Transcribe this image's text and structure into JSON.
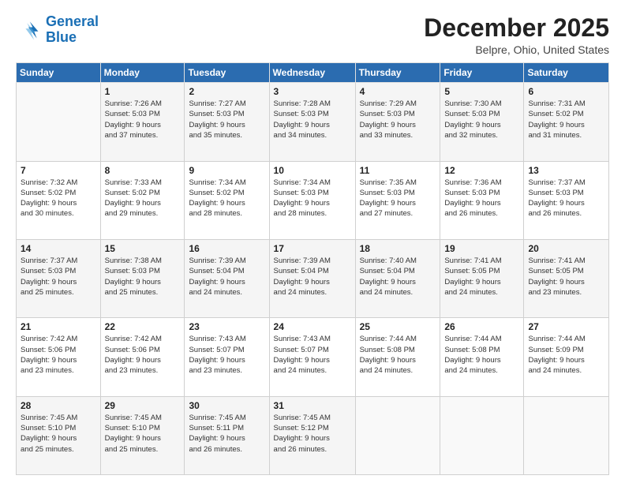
{
  "logo": {
    "line1": "General",
    "line2": "Blue"
  },
  "title": "December 2025",
  "subtitle": "Belpre, Ohio, United States",
  "days_of_week": [
    "Sunday",
    "Monday",
    "Tuesday",
    "Wednesday",
    "Thursday",
    "Friday",
    "Saturday"
  ],
  "weeks": [
    [
      {
        "day": "",
        "info": ""
      },
      {
        "day": "1",
        "info": "Sunrise: 7:26 AM\nSunset: 5:03 PM\nDaylight: 9 hours\nand 37 minutes."
      },
      {
        "day": "2",
        "info": "Sunrise: 7:27 AM\nSunset: 5:03 PM\nDaylight: 9 hours\nand 35 minutes."
      },
      {
        "day": "3",
        "info": "Sunrise: 7:28 AM\nSunset: 5:03 PM\nDaylight: 9 hours\nand 34 minutes."
      },
      {
        "day": "4",
        "info": "Sunrise: 7:29 AM\nSunset: 5:03 PM\nDaylight: 9 hours\nand 33 minutes."
      },
      {
        "day": "5",
        "info": "Sunrise: 7:30 AM\nSunset: 5:03 PM\nDaylight: 9 hours\nand 32 minutes."
      },
      {
        "day": "6",
        "info": "Sunrise: 7:31 AM\nSunset: 5:02 PM\nDaylight: 9 hours\nand 31 minutes."
      }
    ],
    [
      {
        "day": "7",
        "info": "Sunrise: 7:32 AM\nSunset: 5:02 PM\nDaylight: 9 hours\nand 30 minutes."
      },
      {
        "day": "8",
        "info": "Sunrise: 7:33 AM\nSunset: 5:02 PM\nDaylight: 9 hours\nand 29 minutes."
      },
      {
        "day": "9",
        "info": "Sunrise: 7:34 AM\nSunset: 5:02 PM\nDaylight: 9 hours\nand 28 minutes."
      },
      {
        "day": "10",
        "info": "Sunrise: 7:34 AM\nSunset: 5:03 PM\nDaylight: 9 hours\nand 28 minutes."
      },
      {
        "day": "11",
        "info": "Sunrise: 7:35 AM\nSunset: 5:03 PM\nDaylight: 9 hours\nand 27 minutes."
      },
      {
        "day": "12",
        "info": "Sunrise: 7:36 AM\nSunset: 5:03 PM\nDaylight: 9 hours\nand 26 minutes."
      },
      {
        "day": "13",
        "info": "Sunrise: 7:37 AM\nSunset: 5:03 PM\nDaylight: 9 hours\nand 26 minutes."
      }
    ],
    [
      {
        "day": "14",
        "info": "Sunrise: 7:37 AM\nSunset: 5:03 PM\nDaylight: 9 hours\nand 25 minutes."
      },
      {
        "day": "15",
        "info": "Sunrise: 7:38 AM\nSunset: 5:03 PM\nDaylight: 9 hours\nand 25 minutes."
      },
      {
        "day": "16",
        "info": "Sunrise: 7:39 AM\nSunset: 5:04 PM\nDaylight: 9 hours\nand 24 minutes."
      },
      {
        "day": "17",
        "info": "Sunrise: 7:39 AM\nSunset: 5:04 PM\nDaylight: 9 hours\nand 24 minutes."
      },
      {
        "day": "18",
        "info": "Sunrise: 7:40 AM\nSunset: 5:04 PM\nDaylight: 9 hours\nand 24 minutes."
      },
      {
        "day": "19",
        "info": "Sunrise: 7:41 AM\nSunset: 5:05 PM\nDaylight: 9 hours\nand 24 minutes."
      },
      {
        "day": "20",
        "info": "Sunrise: 7:41 AM\nSunset: 5:05 PM\nDaylight: 9 hours\nand 23 minutes."
      }
    ],
    [
      {
        "day": "21",
        "info": "Sunrise: 7:42 AM\nSunset: 5:06 PM\nDaylight: 9 hours\nand 23 minutes."
      },
      {
        "day": "22",
        "info": "Sunrise: 7:42 AM\nSunset: 5:06 PM\nDaylight: 9 hours\nand 23 minutes."
      },
      {
        "day": "23",
        "info": "Sunrise: 7:43 AM\nSunset: 5:07 PM\nDaylight: 9 hours\nand 23 minutes."
      },
      {
        "day": "24",
        "info": "Sunrise: 7:43 AM\nSunset: 5:07 PM\nDaylight: 9 hours\nand 24 minutes."
      },
      {
        "day": "25",
        "info": "Sunrise: 7:44 AM\nSunset: 5:08 PM\nDaylight: 9 hours\nand 24 minutes."
      },
      {
        "day": "26",
        "info": "Sunrise: 7:44 AM\nSunset: 5:08 PM\nDaylight: 9 hours\nand 24 minutes."
      },
      {
        "day": "27",
        "info": "Sunrise: 7:44 AM\nSunset: 5:09 PM\nDaylight: 9 hours\nand 24 minutes."
      }
    ],
    [
      {
        "day": "28",
        "info": "Sunrise: 7:45 AM\nSunset: 5:10 PM\nDaylight: 9 hours\nand 25 minutes."
      },
      {
        "day": "29",
        "info": "Sunrise: 7:45 AM\nSunset: 5:10 PM\nDaylight: 9 hours\nand 25 minutes."
      },
      {
        "day": "30",
        "info": "Sunrise: 7:45 AM\nSunset: 5:11 PM\nDaylight: 9 hours\nand 26 minutes."
      },
      {
        "day": "31",
        "info": "Sunrise: 7:45 AM\nSunset: 5:12 PM\nDaylight: 9 hours\nand 26 minutes."
      },
      {
        "day": "",
        "info": ""
      },
      {
        "day": "",
        "info": ""
      },
      {
        "day": "",
        "info": ""
      }
    ]
  ]
}
